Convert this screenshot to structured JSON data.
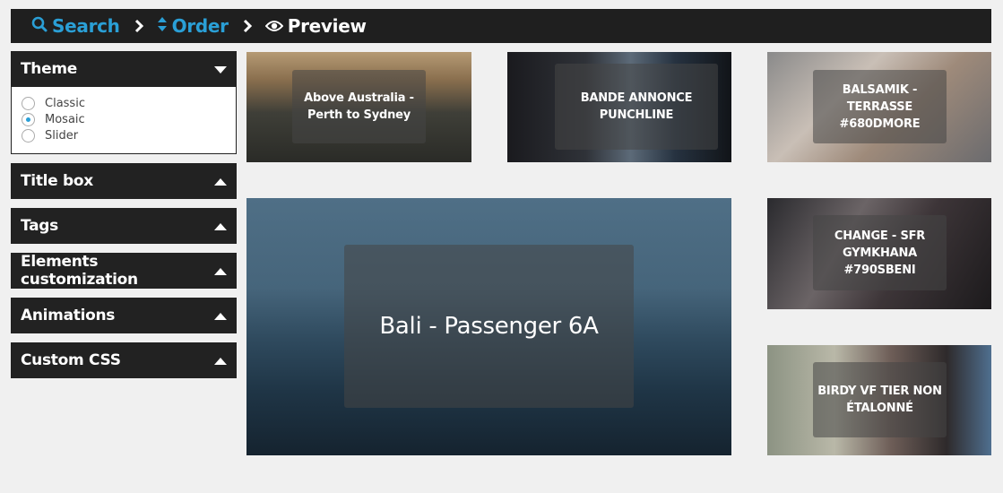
{
  "breadcrumb": {
    "search_label": "Search",
    "order_label": "Order",
    "preview_label": "Preview",
    "active": "preview",
    "accent_color": "#2a9fd6"
  },
  "sidebar": {
    "theme": {
      "title": "Theme",
      "options": [
        "Classic",
        "Mosaic",
        "Slider"
      ],
      "selected": "Mosaic"
    },
    "sections": [
      {
        "title": "Title box"
      },
      {
        "title": "Tags"
      },
      {
        "title": "Elements customization"
      },
      {
        "title": "Animations"
      },
      {
        "title": "Custom CSS"
      }
    ]
  },
  "mosaic": {
    "videos": [
      {
        "title": "Above Australia - Perth to Sydney"
      },
      {
        "title": "BANDE ANNONCE PUNCHLINE"
      },
      {
        "title": "BALSAMIK - TERRASSE #680DMORE"
      },
      {
        "title": "Bali - Passenger 6A"
      },
      {
        "title": "CHANGE - SFR GYMKHANA #790SBENI"
      },
      {
        "title": "BIRDY VF TIER NON ÉTALONNÉ"
      }
    ]
  }
}
